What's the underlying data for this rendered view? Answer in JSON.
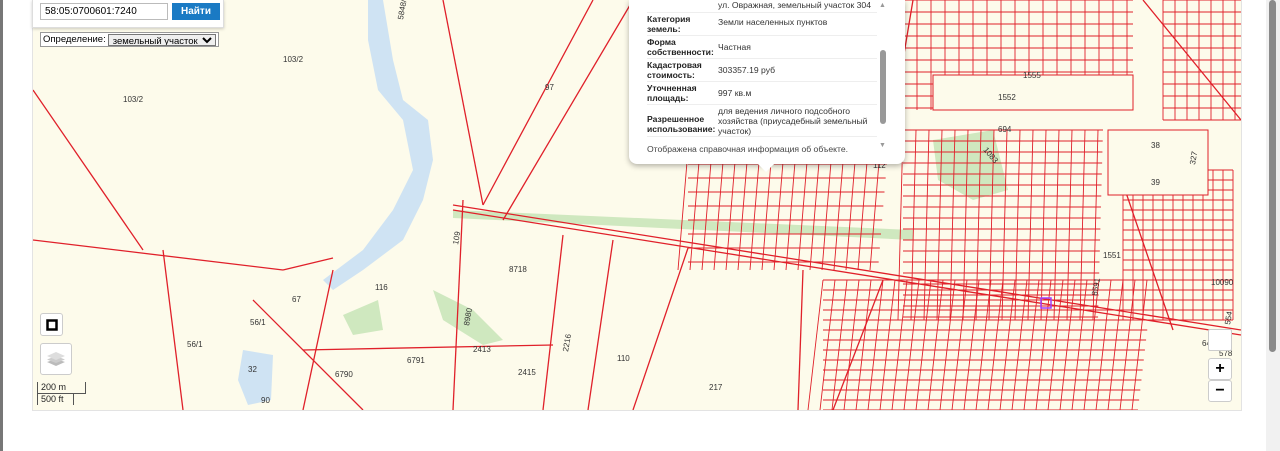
{
  "search": {
    "value": "58:05:0700601:7240",
    "button_label": "Найти"
  },
  "definition": {
    "label": "Определение:",
    "selected": "земельный участок"
  },
  "popup": {
    "address_tail": "ул. Овражная, земельный участок 304",
    "rows": [
      {
        "key": "Категория земель:",
        "value": "Земли населенных пунктов"
      },
      {
        "key": "Форма собственности:",
        "value": "Частная"
      },
      {
        "key": "Кадастровая стоимость:",
        "value": "303357.19 руб"
      },
      {
        "key": "Уточненная площадь:",
        "value": "997 кв.м"
      },
      {
        "key": "Разрешенное использование:",
        "value": "для ведения личного подсобного хозяйства (приусадебный земельный участок)"
      }
    ],
    "footnote": "Отображена справочная информация об объекте."
  },
  "scale": {
    "metric": "200 m",
    "imperial": "500 ft"
  },
  "zoom": {
    "in": "+",
    "out": "−"
  },
  "map_labels": [
    "103/2",
    "103/2",
    "97",
    "8718",
    "116",
    "67",
    "56/1",
    "56/1",
    "32",
    "90",
    "6790",
    "6791",
    "2413",
    "2415",
    "110",
    "217",
    "2216",
    "8980",
    "109",
    "5848/1",
    "112",
    "1555",
    "1552",
    "694",
    "1083",
    "38",
    "39",
    "327",
    "1551",
    "8591",
    "10090",
    "6424/1",
    "578",
    "554"
  ],
  "colors": {
    "accent": "#1a7ac4",
    "parcel": "#e0202a",
    "map_bg": "#fdfbeb",
    "green": "#cfe8bf",
    "water": "#cfe3f3"
  }
}
